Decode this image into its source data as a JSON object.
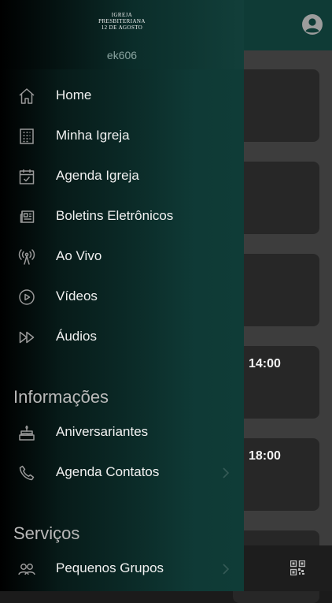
{
  "header": {
    "logo_lines": [
      "IGREJA",
      "PRESBITERIANA",
      "12 DE AGOSTO"
    ],
    "username": "ek606"
  },
  "menu": {
    "items": [
      {
        "label": "Home",
        "icon": "home-icon"
      },
      {
        "label": "Minha Igreja",
        "icon": "building-icon"
      },
      {
        "label": "Agenda Igreja",
        "icon": "calendar-check-icon"
      },
      {
        "label": "Boletins Eletrônicos",
        "icon": "newspaper-icon"
      },
      {
        "label": "Ao Vivo",
        "icon": "broadcast-icon"
      },
      {
        "label": "Vídeos",
        "icon": "play-circle-icon"
      },
      {
        "label": "Áudios",
        "icon": "fast-forward-icon"
      }
    ]
  },
  "sections": {
    "info": {
      "title": "Informações",
      "items": [
        {
          "label": "Aniversariantes",
          "icon": "cake-icon"
        },
        {
          "label": "Agenda Contatos",
          "icon": "phone-icon"
        }
      ]
    },
    "services": {
      "title": "Serviços",
      "items": [
        {
          "label": "Pequenos Grupos",
          "icon": "people-icon"
        }
      ]
    }
  },
  "background": {
    "card_times": [
      "14:00",
      "18:00"
    ]
  },
  "colors": {
    "drawer_accent": "#0f3c37",
    "header_bg": "#0f3b36",
    "label": "#f1f1f1",
    "section_title": "#b9b9b9",
    "icon": "#9a9a9a"
  }
}
